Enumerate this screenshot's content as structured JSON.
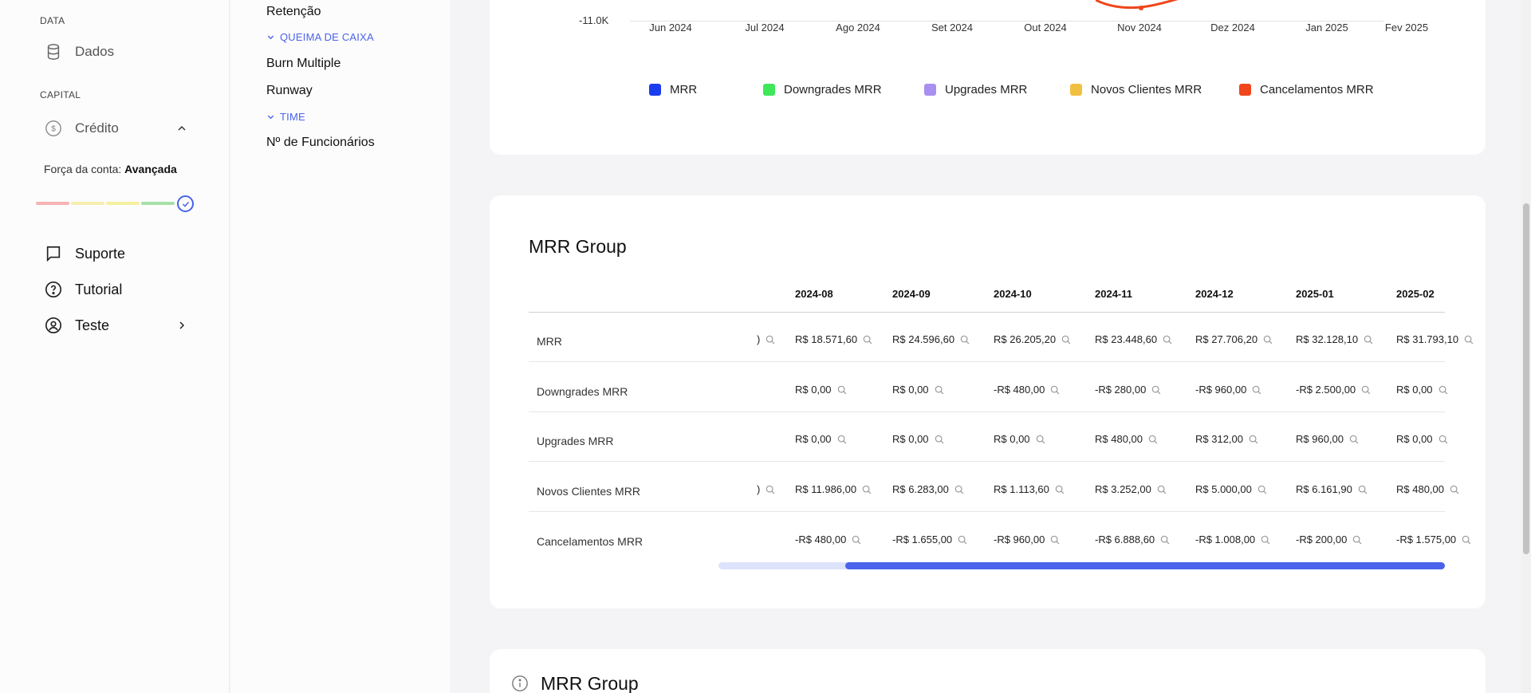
{
  "sidebar": {
    "section_data": "DATA",
    "dados": "Dados",
    "section_capital": "CAPITAL",
    "credito": "Crédito",
    "forca_label": "Força da conta:",
    "forca_value": "Avançada",
    "suporte": "Suporte",
    "tutorial": "Tutorial",
    "teste": "Teste"
  },
  "subnav": {
    "retencao": "Retenção",
    "queima_head": "QUEIMA DE CAIXA",
    "burn_multiple": "Burn Multiple",
    "runway": "Runway",
    "time_head": "TIME",
    "funcionarios": "Nº de Funcionários"
  },
  "chart_data": {
    "type": "line",
    "y_tick_visible": "-11.0K",
    "x": [
      "Jun 2024",
      "Jul 2024",
      "Ago 2024",
      "Set 2024",
      "Out 2024",
      "Nov 2024",
      "Dez 2024",
      "Jan 2025",
      "Fev 2025"
    ],
    "series_legend": [
      {
        "name": "MRR",
        "color": "#1b3df0"
      },
      {
        "name": "Downgrades MRR",
        "color": "#3ee85a"
      },
      {
        "name": "Upgrades MRR",
        "color": "#a98ff0"
      },
      {
        "name": "Novos Clientes MRR",
        "color": "#f2c040"
      },
      {
        "name": "Cancelamentos MRR",
        "color": "#f0461c"
      }
    ]
  },
  "table": {
    "title": "MRR Group",
    "columns": [
      "2024-08",
      "2024-09",
      "2024-10",
      "2024-11",
      "2024-12",
      "2025-01",
      "2025-02"
    ],
    "rows": [
      {
        "label": "MRR",
        "values": [
          "R$ 18.571,60",
          "R$ 24.596,60",
          "R$ 26.205,20",
          "R$ 23.448,60",
          "R$ 27.706,20",
          "R$ 32.128,10",
          "R$ 31.793,10"
        ]
      },
      {
        "label": "Downgrades MRR",
        "values": [
          "R$ 0,00",
          "R$ 0,00",
          "-R$ 480,00",
          "-R$ 280,00",
          "-R$ 960,00",
          "-R$ 2.500,00",
          "R$ 0,00"
        ]
      },
      {
        "label": "Upgrades MRR",
        "values": [
          "R$ 0,00",
          "R$ 0,00",
          "R$ 0,00",
          "R$ 480,00",
          "R$ 312,00",
          "R$ 960,00",
          "R$ 0,00"
        ]
      },
      {
        "label": "Novos Clientes MRR",
        "values": [
          "R$ 11.986,00",
          "R$ 6.283,00",
          "R$ 1.113,60",
          "R$ 3.252,00",
          "R$ 5.000,00",
          "R$ 6.161,90",
          "R$ 480,00"
        ]
      },
      {
        "label": "Cancelamentos MRR",
        "values": [
          "-R$ 480,00",
          "-R$ 1.655,00",
          "-R$ 960,00",
          "-R$ 6.888,60",
          "-R$ 1.008,00",
          "-R$ 200,00",
          "-R$ 1.575,00"
        ]
      }
    ],
    "clipped_cell": ")"
  },
  "card3": {
    "title": "MRR Group"
  }
}
